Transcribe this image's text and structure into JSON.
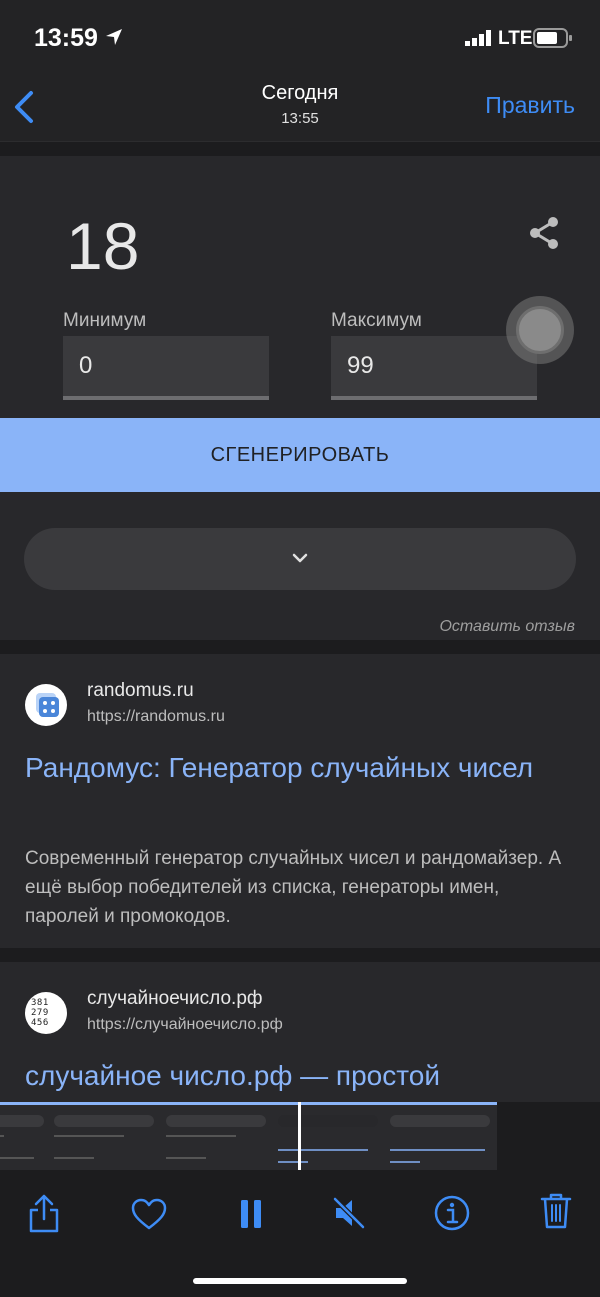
{
  "status_bar": {
    "time": "13:59",
    "network": "LTE",
    "icons": [
      "location-arrow-icon",
      "signal-icon",
      "battery-icon"
    ]
  },
  "nav": {
    "title": "Сегодня",
    "subtitle": "13:55",
    "edit_label": "Править",
    "back_icon": "chevron-left-icon"
  },
  "rng": {
    "result": "18",
    "min_label": "Минимум",
    "min_value": "0",
    "max_label": "Максимум",
    "max_value": "99",
    "generate_label": "СГЕНЕРИРОВАТЬ",
    "feedback_label": "Оставить отзыв"
  },
  "results": [
    {
      "site_name": "randomus.ru",
      "url": "https://randomus.ru",
      "title": "Рандомус: Генератор случайных чисел",
      "snippet": "Современный генератор случайных чисел и рандомайзер. А ещё выбор победителей из списка, генераторы имен, паролей и промокодов."
    },
    {
      "site_name": "случайноечисло.рф",
      "url": "https://случайноечисло.рф",
      "title": "случайное число.рф — простой",
      "logo_text": [
        "381",
        "279",
        "456"
      ]
    }
  ],
  "toolbar": {
    "icons": [
      "share-icon",
      "heart-icon",
      "pause-icon",
      "mute-icon",
      "info-icon",
      "trash-icon"
    ]
  },
  "colors": {
    "accent": "#3e8cf5",
    "link": "#8ab4f8",
    "background": "#1c1c1e",
    "card": "#28282b"
  }
}
